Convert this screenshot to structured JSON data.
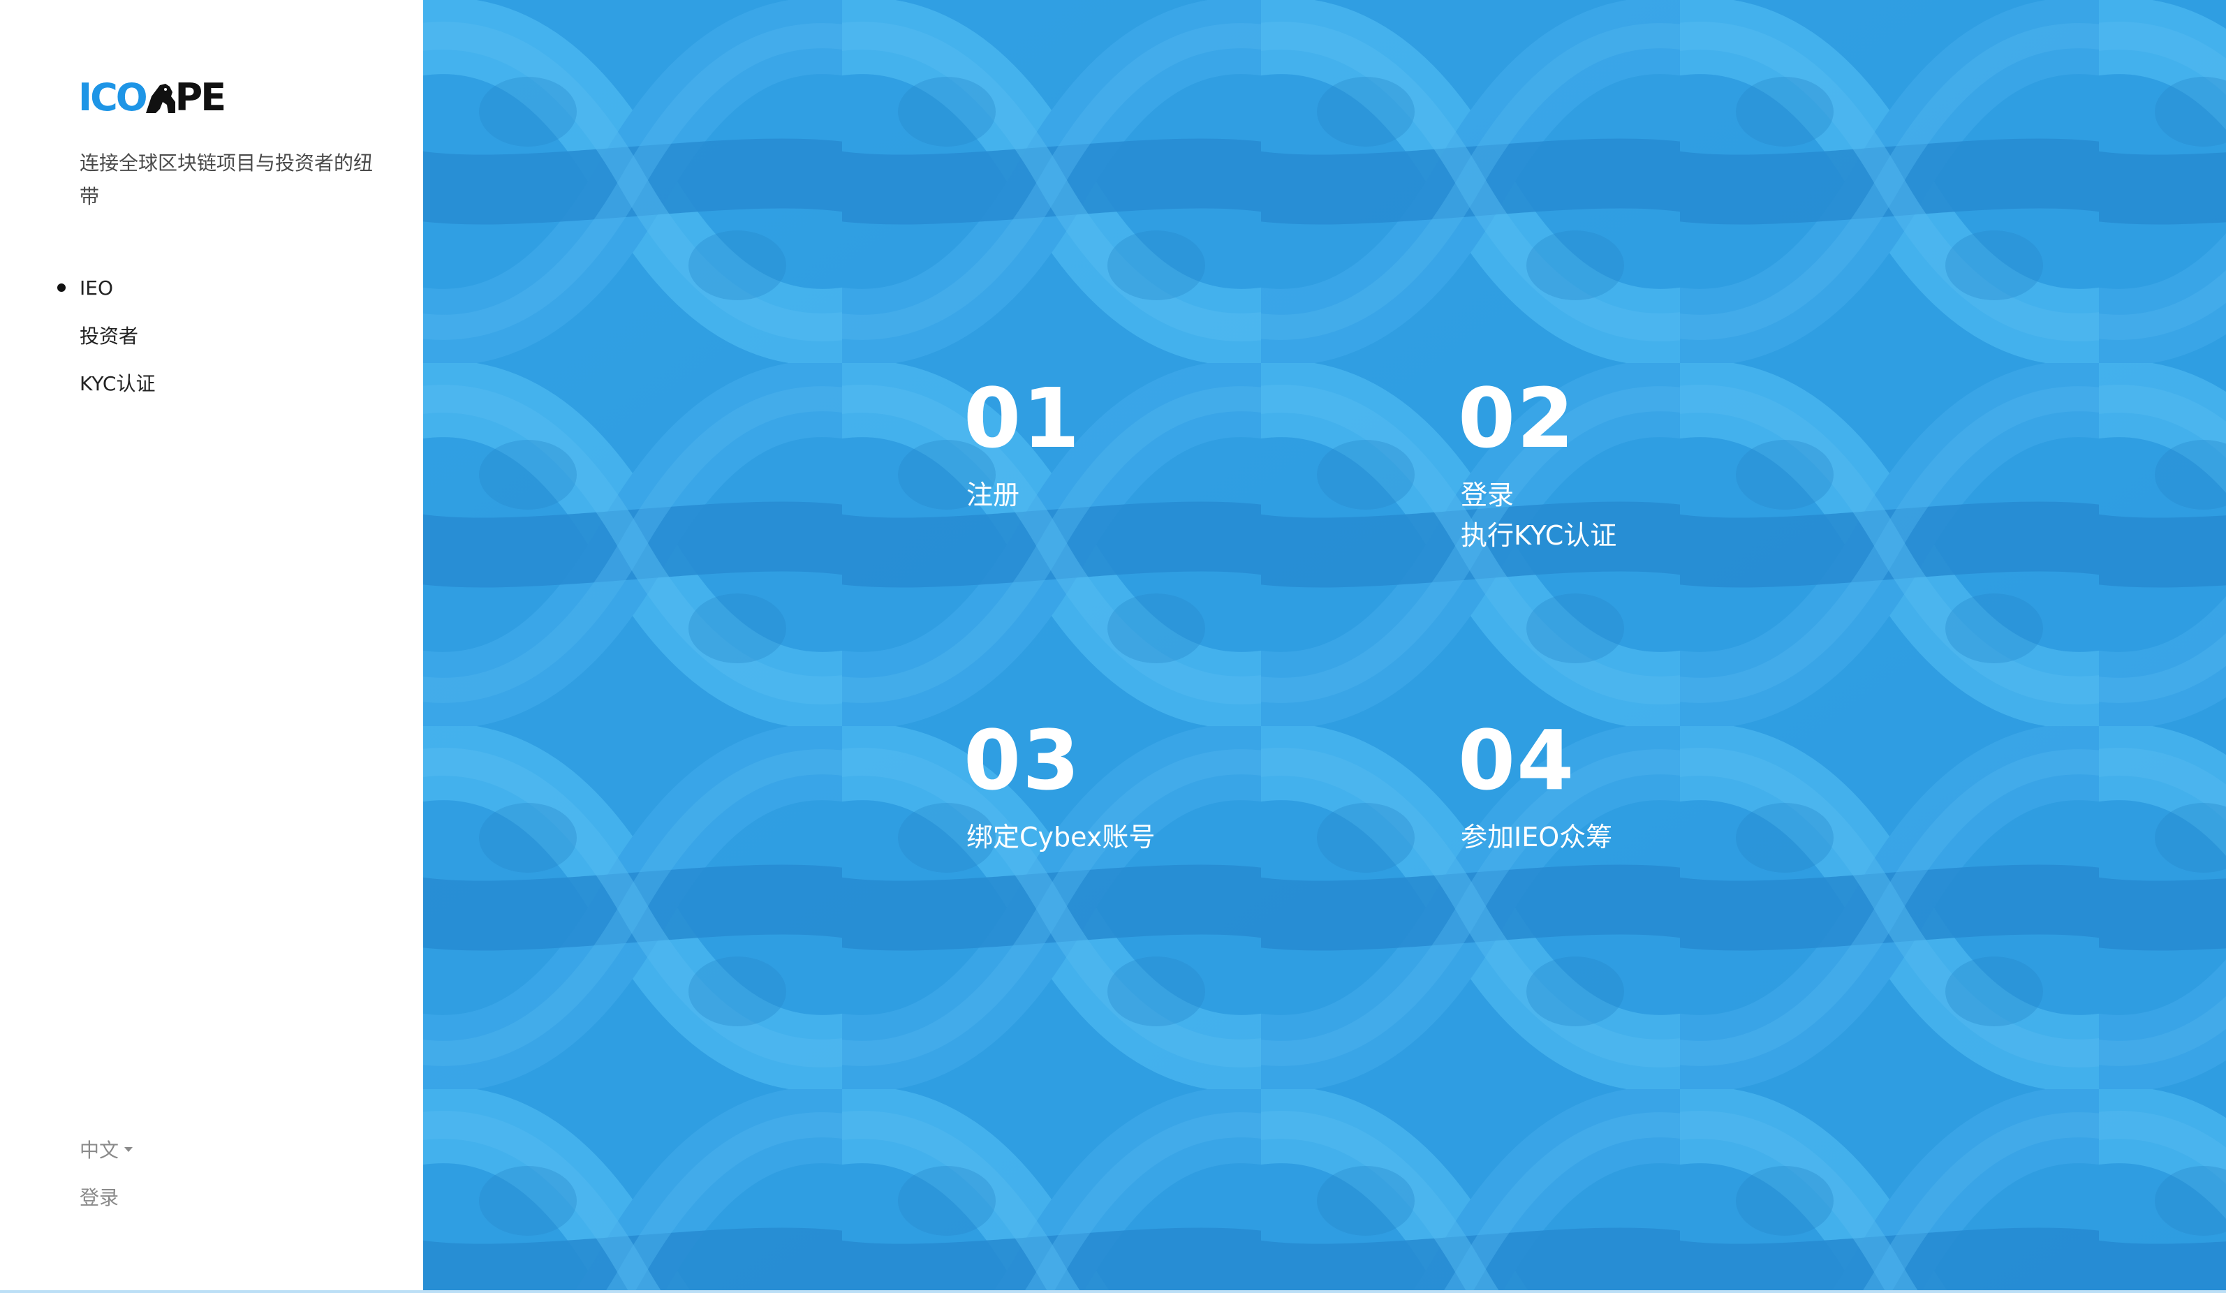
{
  "sidebar": {
    "logo": {
      "part1": "ICO",
      "part2": "PE"
    },
    "tagline": "连接全球区块链项目与投资者的纽带",
    "nav": [
      {
        "label": "IEO",
        "active": true
      },
      {
        "label": "投资者",
        "active": false
      },
      {
        "label": "KYC认证",
        "active": false
      }
    ],
    "language": "中文",
    "login": "登录"
  },
  "hero": {
    "steps": [
      {
        "number": "01",
        "text": "注册"
      },
      {
        "number": "02",
        "text": "登录\n执行KYC认证"
      },
      {
        "number": "03",
        "text": "绑定Cybex账号"
      },
      {
        "number": "04",
        "text": "参加IEO众筹"
      }
    ]
  },
  "colors": {
    "brand_blue": "#1e95e6",
    "hero_blue": "#2f9ee2",
    "text_dark": "#222222",
    "text_muted": "#8a8a8a"
  },
  "icons": {
    "logo_mark": "ape-silhouette-icon",
    "active_nav": "bullet-dot-icon",
    "language_caret": "caret-down-icon"
  }
}
